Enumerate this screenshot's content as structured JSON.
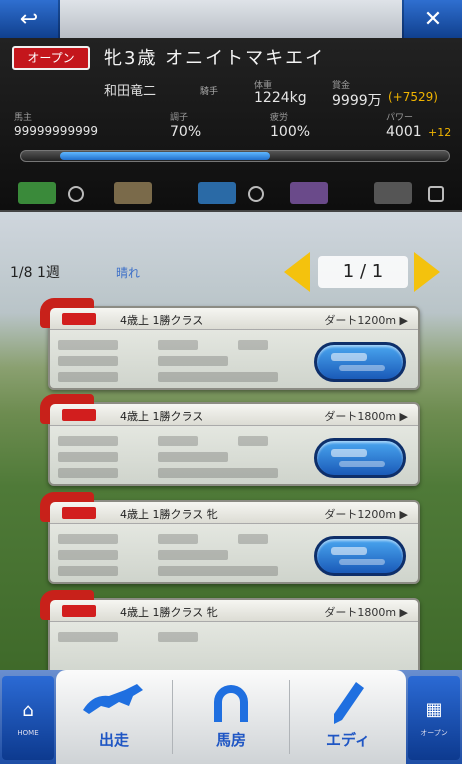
{
  "nav": {
    "back_icon": "↩",
    "close_icon": "✕"
  },
  "horse": {
    "badge": "オープン",
    "name": "牝3歳 オニイトマキエイ",
    "jockey": "和田竜二",
    "jockey_tag": "騎手",
    "stat_a_label": "体重",
    "stat_a_value": "1224kg",
    "stat_b_label": "賞金",
    "stat_b_value": "9999万",
    "stat_b_accent": "(+7529)",
    "row3_a_label": "馬主",
    "row3_a_value": "99999999999",
    "row3_b_label": "調子",
    "row3_b_value": "70%",
    "row3_c_label": "疲労",
    "row3_c_value": "100%",
    "row3_d_label": "パワー",
    "row3_d_value": "4001",
    "row3_d_accent": "+12",
    "progress_fraction": 0.49
  },
  "races": {
    "count_label": "1/8 1週",
    "weather": "晴れ",
    "page": "1 / 1"
  },
  "cards": [
    {
      "head": "4歳上 1勝クラス",
      "right": "ダート1200m ▶"
    },
    {
      "head": "4歳上 1勝クラス",
      "right": "ダート1800m ▶"
    },
    {
      "head": "4歳上 1勝クラス 牝",
      "right": "ダート1200m ▶"
    },
    {
      "head": "4歳上 1勝クラス 牝",
      "right": "ダート1800m ▶"
    }
  ],
  "bottom": {
    "home_label": "HOME",
    "other_label": "オープン",
    "tabs": [
      {
        "label": "出走",
        "icon": "horse-icon"
      },
      {
        "label": "馬房",
        "icon": "horseshoe-icon"
      },
      {
        "label": "エディ",
        "icon": "pen-icon"
      }
    ]
  },
  "colors": {
    "accent_blue": "#1f56c4",
    "badge_red": "#c4161c",
    "arrow_yellow": "#f4c20d"
  }
}
